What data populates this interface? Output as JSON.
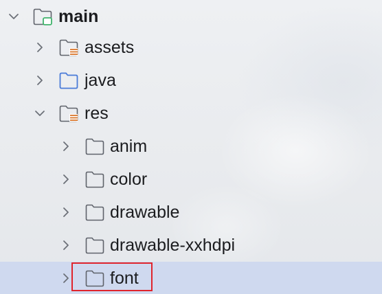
{
  "tree": {
    "items": [
      {
        "label": "main",
        "expanded": true,
        "icon": "module-folder-icon",
        "bold": true
      },
      {
        "label": "assets",
        "expanded": false,
        "icon": "resource-folder-icon"
      },
      {
        "label": "java",
        "expanded": false,
        "icon": "source-folder-icon"
      },
      {
        "label": "res",
        "expanded": true,
        "icon": "resource-folder-icon"
      },
      {
        "label": "anim",
        "expanded": false,
        "icon": "folder-icon"
      },
      {
        "label": "color",
        "expanded": false,
        "icon": "folder-icon"
      },
      {
        "label": "drawable",
        "expanded": false,
        "icon": "folder-icon"
      },
      {
        "label": "drawable-xxhdpi",
        "expanded": false,
        "icon": "folder-icon"
      },
      {
        "label": "font",
        "expanded": false,
        "icon": "folder-icon",
        "selected": true,
        "highlighted": true
      }
    ]
  },
  "colors": {
    "selection": "#cfd9ef",
    "highlight_border": "#e0242c",
    "source_folder": "#4a7bd8",
    "resource_lines": "#d8752a",
    "module_badge": "#3fb36b"
  }
}
